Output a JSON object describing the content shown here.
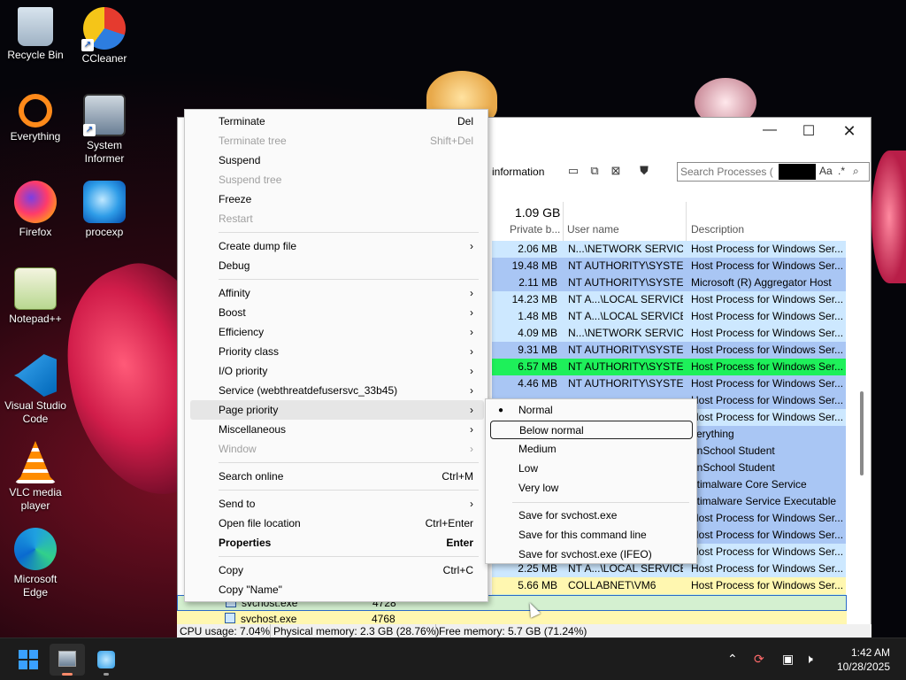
{
  "desktop": {
    "icons": [
      {
        "label": "Recycle Bin"
      },
      {
        "label": "CCleaner"
      },
      {
        "label": "Everything"
      },
      {
        "label": "System Informer"
      },
      {
        "label": "Firefox"
      },
      {
        "label": "procexp"
      },
      {
        "label": "Notepad++"
      },
      {
        "label": "Visual Studio Code"
      },
      {
        "label": "VLC media player"
      },
      {
        "label": "Microsoft Edge"
      }
    ]
  },
  "window": {
    "toolbar_text": "information",
    "search_placeholder": "Search Processes (",
    "search_option_case": "Aa",
    "search_option_regex": ".*",
    "memory_total": "1.09 GB",
    "columns": {
      "private_bytes": "Private b...",
      "user_name": "User name",
      "description": "Description"
    },
    "rows": [
      {
        "mem": "2.06 MB",
        "user": "N...\\NETWORK SERVICE",
        "desc": "Host Process for Windows Ser...",
        "bg": "#cde8ff"
      },
      {
        "mem": "19.48 MB",
        "user": "NT AUTHORITY\\SYSTEM",
        "desc": "Host Process for Windows Ser...",
        "bg": "#a9c6f4"
      },
      {
        "mem": "2.11 MB",
        "user": "NT AUTHORITY\\SYSTEM",
        "desc": "Microsoft (R) Aggregator Host",
        "bg": "#a9c6f4"
      },
      {
        "mem": "14.23 MB",
        "user": "NT A...\\LOCAL SERVICE",
        "desc": "Host Process for Windows Ser...",
        "bg": "#cde8ff"
      },
      {
        "mem": "1.48 MB",
        "user": "NT A...\\LOCAL SERVICE",
        "desc": "Host Process for Windows Ser...",
        "bg": "#cde8ff"
      },
      {
        "mem": "4.09 MB",
        "user": "N...\\NETWORK SERVICE",
        "desc": "Host Process for Windows Ser...",
        "bg": "#cde8ff"
      },
      {
        "mem": "9.31 MB",
        "user": "NT AUTHORITY\\SYSTEM",
        "desc": "Host Process for Windows Ser...",
        "bg": "#a9c6f4"
      },
      {
        "mem": "6.57 MB",
        "user": "NT AUTHORITY\\SYSTEM",
        "desc": "Host Process for Windows Ser...",
        "bg": "#1ef05a"
      },
      {
        "mem": "4.46 MB",
        "user": "NT AUTHORITY\\SYSTEM",
        "desc": "Host Process for Windows Ser...",
        "bg": "#a9c6f4"
      },
      {
        "mem": "",
        "user": "",
        "desc": "Host Process for Windows Ser...",
        "bg": "#a9c6f4"
      },
      {
        "mem": "",
        "user": "",
        "desc": "Host Process for Windows Ser...",
        "bg": "#cde8ff"
      },
      {
        "mem": "",
        "user": "",
        "desc": "verything",
        "bg": "#a9c6f4"
      },
      {
        "mem": "",
        "user": "",
        "desc": "anSchool Student",
        "bg": "#a9c6f4"
      },
      {
        "mem": "",
        "user": "",
        "desc": "anSchool Student",
        "bg": "#a9c6f4"
      },
      {
        "mem": "",
        "user": "",
        "desc": "ntimalware Core Service",
        "bg": "#a9c6f4"
      },
      {
        "mem": "",
        "user": "",
        "desc": "ntimalware Service Executable",
        "bg": "#a9c6f4"
      },
      {
        "mem": "",
        "user": "",
        "desc": "Host Process for Windows Ser...",
        "bg": "#a9c6f4"
      },
      {
        "mem": "",
        "user": "",
        "desc": "Host Process for Windows Ser...",
        "bg": "#a9c6f4"
      },
      {
        "mem": "",
        "user": "",
        "desc": "Host Process for Windows Ser...",
        "bg": "#cde8ff"
      },
      {
        "mem": "2.25 MB",
        "user": "NT A...\\LOCAL SERVICE",
        "desc": "Host Process for Windows Ser...",
        "bg": "#cde8ff"
      },
      {
        "mem": "5.66 MB",
        "user": "COLLABNET\\VM6",
        "desc": "Host Process for Windows Ser...",
        "bg": "#fff7b0"
      },
      {
        "mem": "1.22 MB",
        "user": "COLLABNET\\VM6",
        "desc": "Host Process for Windows Ser...",
        "bg": "#d4f0d0"
      },
      {
        "mem": "5.19 MB",
        "user": "COLLABNET\\VM6",
        "desc": "Host Process for Windows Ser...",
        "bg": "#fff7b0"
      }
    ],
    "bottom_rows": [
      {
        "name": "svchost.exe",
        "pid": "4728"
      },
      {
        "name": "svchost.exe",
        "pid": "4768"
      }
    ],
    "status": {
      "cpu": "CPU usage: 7.04%",
      "physical": "Physical memory: 2.3 GB (28.76%)",
      "free": "Free memory: 5.7 GB (71.24%)"
    }
  },
  "context_menu": {
    "items": [
      {
        "label": "Terminate",
        "shortcut": "Del"
      },
      {
        "label": "Terminate tree",
        "shortcut": "Shift+Del"
      },
      {
        "label": "Suspend",
        "shortcut": ""
      },
      {
        "label": "Suspend tree",
        "shortcut": ""
      },
      {
        "label": "Freeze",
        "shortcut": ""
      },
      {
        "label": "Restart",
        "shortcut": ""
      },
      {
        "label": "Create dump file",
        "shortcut": ""
      },
      {
        "label": "Debug",
        "shortcut": ""
      },
      {
        "label": "Affinity",
        "shortcut": ""
      },
      {
        "label": "Boost",
        "shortcut": ""
      },
      {
        "label": "Efficiency",
        "shortcut": ""
      },
      {
        "label": "Priority class",
        "shortcut": ""
      },
      {
        "label": "I/O priority",
        "shortcut": ""
      },
      {
        "label": "Service (webthreatdefusersvc_33b45)",
        "shortcut": ""
      },
      {
        "label": "Page priority",
        "shortcut": ""
      },
      {
        "label": "Miscellaneous",
        "shortcut": ""
      },
      {
        "label": "Window",
        "shortcut": ""
      },
      {
        "label": "Search online",
        "shortcut": "Ctrl+M"
      },
      {
        "label": "Send to",
        "shortcut": ""
      },
      {
        "label": "Open file location",
        "shortcut": "Ctrl+Enter"
      },
      {
        "label": "Properties",
        "shortcut": "Enter"
      },
      {
        "label": "Copy",
        "shortcut": "Ctrl+C"
      },
      {
        "label": "Copy \"Name\"",
        "shortcut": ""
      }
    ]
  },
  "submenu": {
    "items": [
      {
        "label": "Normal"
      },
      {
        "label": "Below normal"
      },
      {
        "label": "Medium"
      },
      {
        "label": "Low"
      },
      {
        "label": "Very low"
      },
      {
        "label": "Save for svchost.exe"
      },
      {
        "label": "Save for this command line"
      },
      {
        "label": "Save for svchost.exe (IFEO)"
      }
    ]
  },
  "taskbar": {
    "time": "1:42 AM",
    "date": "10/28/2025"
  }
}
